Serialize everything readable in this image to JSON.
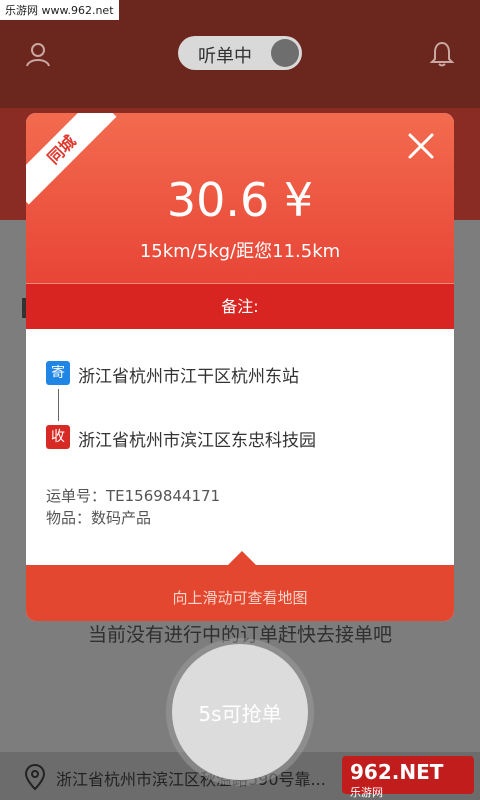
{
  "watermark_top": "乐游网 www.962.net",
  "header": {
    "toggle_label": "听单中"
  },
  "empty_message": "当前没有进行中的订单赶快去接单吧",
  "grab_button": "5s可抢单",
  "bottom_address": "浙江省杭州市滨江区秋溢路590号靠...",
  "watermark_logo": {
    "brand": "962.NET",
    "text": "乐游网"
  },
  "order_card": {
    "ribbon": "同城",
    "price": "30.6 ¥",
    "meta": "15km/5kg/距您11.5km",
    "note_label": "备注:",
    "send_badge": "寄",
    "from_address": "浙江省杭州市江干区杭州东站",
    "recv_badge": "收",
    "to_address": "浙江省杭州市滨江区东忠科技园",
    "order_no": "运单号：TE1569844171",
    "goods": "物品：数码产品",
    "footer_hint": "向上滑动可查看地图"
  },
  "colors": {
    "accent_red": "#e84536",
    "send_blue": "#1f86e6",
    "recv_red": "#d82a25"
  }
}
